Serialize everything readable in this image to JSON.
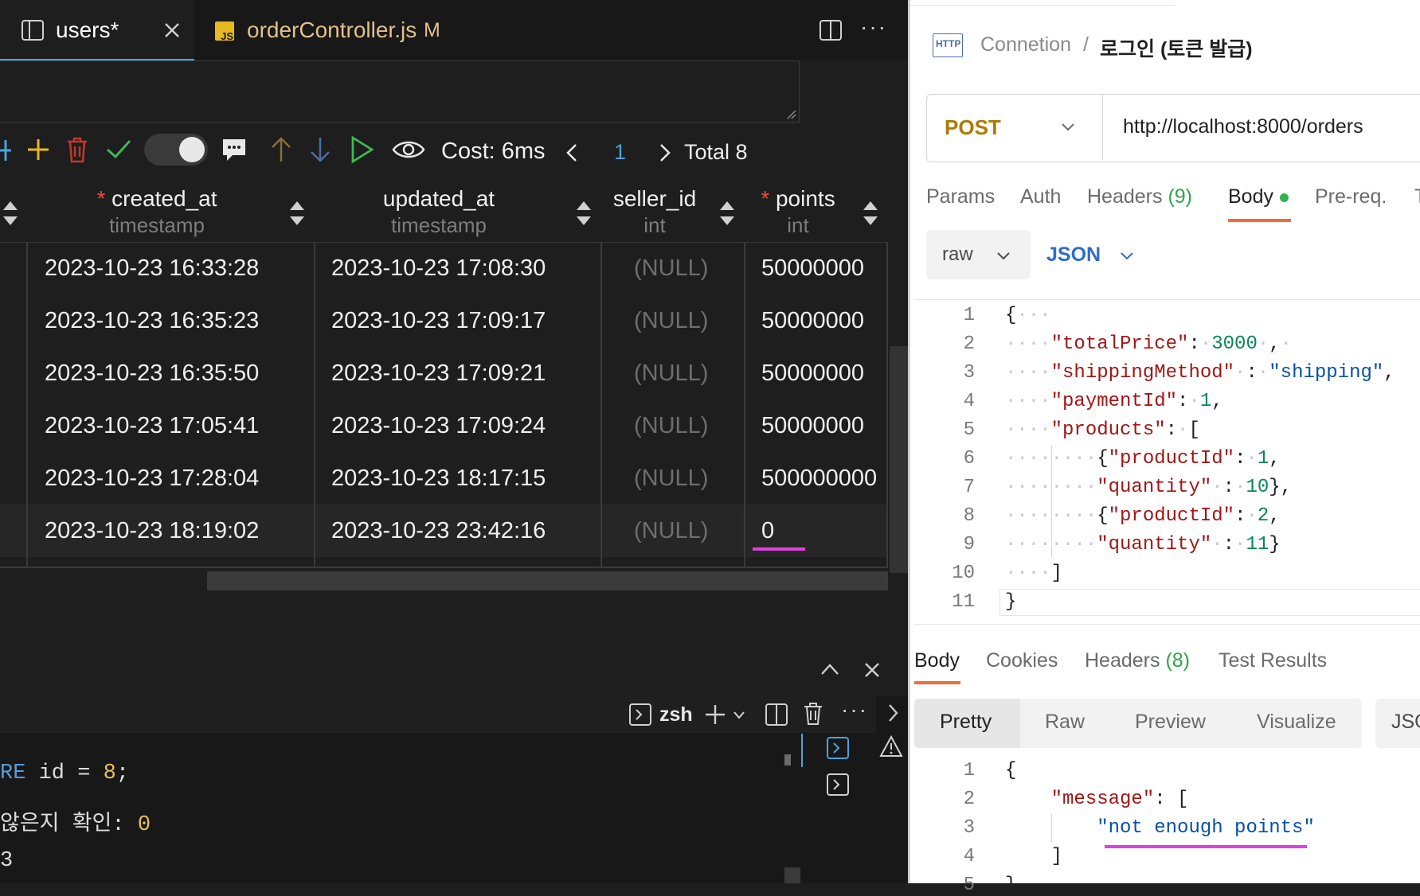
{
  "vscode": {
    "tabs": [
      {
        "label": "users*"
      },
      {
        "label": "orderController.js",
        "badge": "M",
        "icon_text": "JS"
      }
    ],
    "toolbar": {
      "cost_label": "Cost: 6ms",
      "page_number": "1",
      "total_label": "Total 8"
    },
    "grid": {
      "columns": [
        {
          "name": "created_at",
          "type": "timestamp",
          "required": "*"
        },
        {
          "name": "updated_at",
          "type": "timestamp",
          "required": ""
        },
        {
          "name": "seller_id",
          "type": "int",
          "required": ""
        },
        {
          "name": "points",
          "type": "int",
          "required": "*"
        }
      ],
      "rows": [
        [
          "2023-10-23 16:33:28",
          "2023-10-23 17:08:30",
          "(NULL)",
          "50000000"
        ],
        [
          "2023-10-23 16:35:23",
          "2023-10-23 17:09:17",
          "(NULL)",
          "50000000"
        ],
        [
          "2023-10-23 16:35:50",
          "2023-10-23 17:09:21",
          "(NULL)",
          "50000000"
        ],
        [
          "2023-10-23 17:05:41",
          "2023-10-23 17:09:24",
          "(NULL)",
          "50000000"
        ],
        [
          "2023-10-23 17:28:04",
          "2023-10-23 18:17:15",
          "(NULL)",
          "500000000"
        ],
        [
          "2023-10-23 18:19:02",
          "2023-10-23 23:42:16",
          "(NULL)",
          "0"
        ]
      ]
    },
    "terminal": {
      "shell_label": "zsh",
      "line1_kw": "RE",
      "line1_rest": " id = ",
      "line1_num": "8",
      "line1_end": ";",
      "line2_text": "않은지 확인: ",
      "line2_num": "0",
      "line3_text": "3"
    },
    "colors": {
      "accent_toggle": "#3a3a3a",
      "highlight_underline": "#e040e0"
    }
  },
  "postman": {
    "breadcrumb": {
      "collection": "Connetion",
      "separator": "/",
      "request": "로그인 (토큰 발급)",
      "icon_text": "HTTP"
    },
    "request": {
      "method": "POST",
      "url": "http://localhost:8000/orders"
    },
    "tabs": [
      {
        "label": "Params"
      },
      {
        "label": "Auth"
      },
      {
        "label": "Headers",
        "count": "(9)"
      },
      {
        "label": "Body"
      },
      {
        "label": "Pre-req."
      },
      {
        "label": "T"
      }
    ],
    "body_type": {
      "mode": "raw",
      "format": "JSON"
    },
    "request_body_lines": [
      "1",
      "2",
      "3",
      "4",
      "5",
      "6",
      "7",
      "8",
      "9",
      "10",
      "11"
    ],
    "request_body": {
      "totalPrice_key": "\"totalPrice\"",
      "totalPrice_val": "3000",
      "shippingMethod_key": "\"shippingMethod\"",
      "shippingMethod_val": "\"shipping\"",
      "paymentId_key": "\"paymentId\"",
      "paymentId_val": "1",
      "products_key": "\"products\"",
      "productId_key": "\"productId\"",
      "quantity_key": "\"quantity\"",
      "p1_id": "1",
      "p1_qty": "10",
      "p2_id": "2",
      "p2_qty": "11"
    },
    "response_tabs": [
      {
        "label": "Body"
      },
      {
        "label": "Cookies"
      },
      {
        "label": "Headers",
        "count": "(8)"
      },
      {
        "label": "Test Results"
      }
    ],
    "response_view": [
      "Pretty",
      "Raw",
      "Preview",
      "Visualize",
      "JSO"
    ],
    "response_lines": [
      "1",
      "2",
      "3",
      "4",
      "5"
    ],
    "response_body": {
      "message_key": "\"message\"",
      "message_val": "\"not enough points\""
    },
    "colors": {
      "method": "#ad7a03",
      "tab_active_underline": "#f26b3a",
      "body_dot": "#2fb34a",
      "json_blue": "#2f6bcf"
    }
  }
}
